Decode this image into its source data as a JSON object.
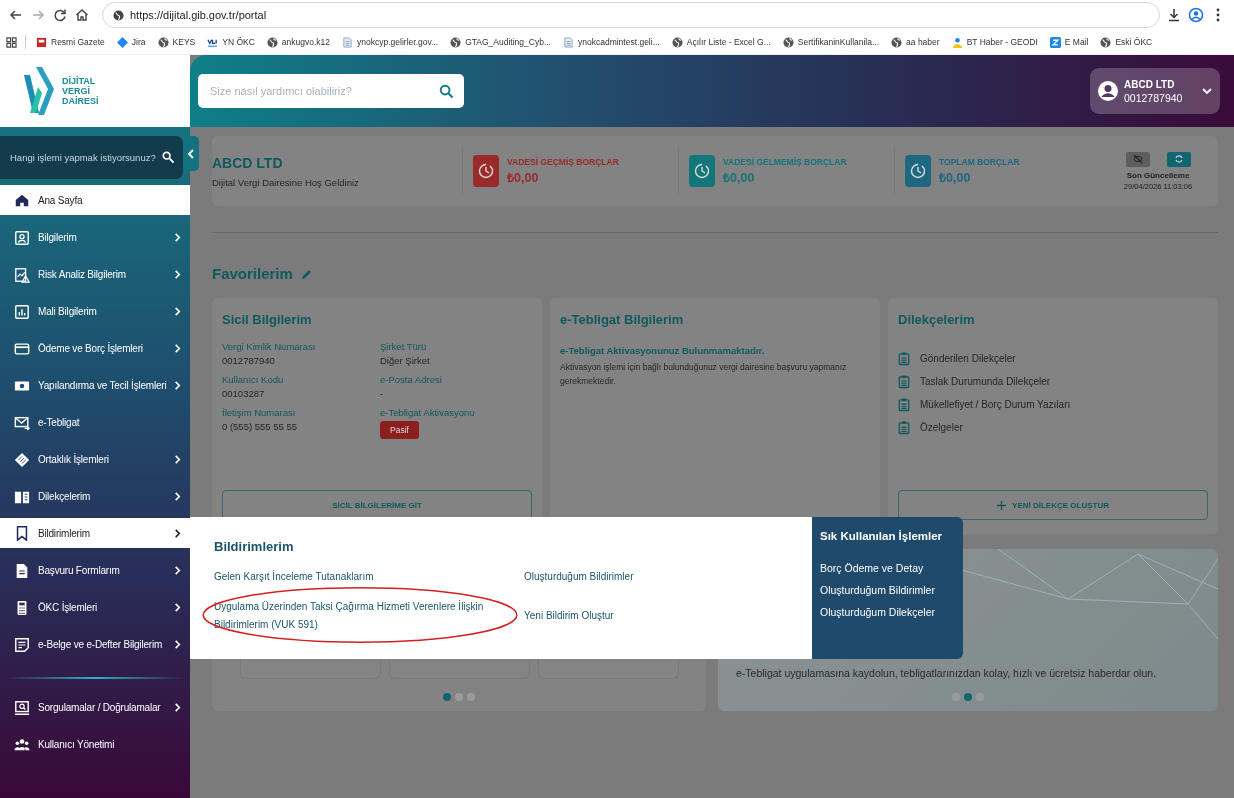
{
  "browser": {
    "url": "https://dijital.gib.gov.tr/portal",
    "bookmarks": [
      {
        "label": "Resmi Gazete",
        "kind": "page"
      },
      {
        "label": "Jira",
        "kind": "diamond"
      },
      {
        "label": "KEYS",
        "kind": "globe"
      },
      {
        "label": "YN ÖKC",
        "kind": "logo"
      },
      {
        "label": "ankugvo.k12",
        "kind": "globe"
      },
      {
        "label": "ynokcyp.gelirler.gov...",
        "kind": "doc"
      },
      {
        "label": "GTAG_Auditing_Cyb...",
        "kind": "globe"
      },
      {
        "label": "ynokcadmintest.geli...",
        "kind": "doc"
      },
      {
        "label": "Açılır Liste - Excel G...",
        "kind": "globe"
      },
      {
        "label": "SertifikaninKullanila...",
        "kind": "globe"
      },
      {
        "label": "aa haber",
        "kind": "globe"
      },
      {
        "label": "BT Haber - GEODI",
        "kind": "person"
      },
      {
        "label": "E Mail",
        "kind": "mail"
      },
      {
        "label": "Eski ÖKC",
        "kind": "globe"
      }
    ]
  },
  "header": {
    "logo_lines": [
      "DİJİTAL",
      "VERGİ",
      "DAİRESİ"
    ],
    "search_placeholder": "Size nasıl yardımcı olabiliriz?",
    "user": {
      "name": "ABCD LTD",
      "number": "0012787940"
    }
  },
  "sidebar": {
    "search_placeholder": "Hangi işlemi yapmak istiyorsunuz?",
    "sections": [
      {
        "items": [
          {
            "label": "Ana Sayfa",
            "has_submenu": false,
            "selected": true
          },
          {
            "label": "Bilgilerim",
            "has_submenu": true,
            "selected": false
          },
          {
            "label": "Risk Analiz Bilgilerim",
            "has_submenu": true,
            "selected": false
          },
          {
            "label": "Mali Bilgilerim",
            "has_submenu": true,
            "selected": false
          },
          {
            "label": "Ödeme ve Borç İşlemleri",
            "has_submenu": true,
            "selected": false
          },
          {
            "label": "Yapılandırma ve Tecil İşlemleri",
            "has_submenu": true,
            "selected": false
          },
          {
            "label": "e-Tebligat",
            "has_submenu": false,
            "selected": false
          },
          {
            "label": "Ortaklık İşlemleri",
            "has_submenu": true,
            "selected": false
          },
          {
            "label": "Dilekçelerim",
            "has_submenu": true,
            "selected": false
          },
          {
            "label": "Bildirimlerim",
            "has_submenu": true,
            "selected": true
          },
          {
            "label": "Başvuru Formlarım",
            "has_submenu": true,
            "selected": false
          },
          {
            "label": "ÖKC İşlemleri",
            "has_submenu": true,
            "selected": false
          },
          {
            "label": "e-Belge ve e-Defter Bilgilerim",
            "has_submenu": true,
            "selected": false
          }
        ]
      },
      {
        "items": [
          {
            "label": "Sorgulamalar / Doğrulamalar",
            "has_submenu": true,
            "selected": false
          },
          {
            "label": "Kullanıcı Yönetimi",
            "has_submenu": false,
            "selected": false
          }
        ]
      }
    ]
  },
  "summary": {
    "company": "ABCD LTD",
    "welcome": "Dijital Vergi Dairesine Hoş Geldiniz",
    "stats": [
      {
        "label": "VADESİ GEÇMİŞ BORÇLAR",
        "amount": "₺0,00",
        "color": "#9b2a2a"
      },
      {
        "label": "VADESİ GELMEMİŞ BORÇLAR",
        "amount": "₺0,00",
        "color": "#13767a"
      },
      {
        "label": "TOPLAM BORÇLAR",
        "amount": "₺0,00",
        "color": "#1d6780"
      }
    ],
    "last_update": {
      "label": "Son Güncelleme",
      "time": "29/04/2026 11:03:06"
    }
  },
  "favorites": {
    "title": "Favorilerim",
    "registry": {
      "title": "Sicil Bilgilerim",
      "fields": [
        {
          "label": "Vergi Kimlik Numarası",
          "value": "0012787940",
          "kind": "text"
        },
        {
          "label": "Şirket Türü",
          "value": "Diğer Şirket",
          "kind": "text"
        },
        {
          "label": "Kullanıcı Kodu",
          "value": "00103287",
          "kind": "text"
        },
        {
          "label": "e-Posta Adresi",
          "value": "-",
          "kind": "text"
        },
        {
          "label": "İletişim Numarası",
          "value": "0 (555) 555 55 55",
          "kind": "text"
        },
        {
          "label": "e-Tebligat Aktivasyonu",
          "value": "Pasif",
          "kind": "badge"
        }
      ],
      "button": "SİCİL BİLGİLERİME GİT"
    },
    "notification": {
      "title": "e-Tebligat Bilgilerim",
      "headline": "e-Tebligat Aktivasyonunuz Bulunmamaktadır.",
      "text": "Aktivasyon işlemi için bağlı bulunduğunuz vergi dairesine başvuru yapmanız gerekmektedir."
    },
    "petitions": {
      "title": "Dilekçelerim",
      "items": [
        "Gönderilen Dilekçeler",
        "Taslak Durumunda Dilekçeler",
        "Mükellefiyet / Borç Durum Yazıları",
        "Özelgeler"
      ],
      "button": "YENİ DİLEKÇE OLUŞTUR"
    }
  },
  "services": {
    "dots": [
      {
        "selected": true
      },
      {
        "selected": false
      },
      {
        "selected": false
      }
    ]
  },
  "banner": {
    "text": "e-Tebligat uygulamasına kaydolun, tebligatlarınızdan kolay, hızlı ve ücretsiz haberdar olun.",
    "dots": [
      {
        "selected": false
      },
      {
        "selected": true
      },
      {
        "selected": false
      }
    ]
  },
  "menu": {
    "title": "Bildirimlerim",
    "links": [
      {
        "label": "Gelen Karşıt İnceleme Tutanaklarım",
        "highlighted": false
      },
      {
        "label": "Oluşturduğum Bildirimler",
        "highlighted": false
      },
      {
        "label": "Uygulama Üzerinden Taksi Çağırma Hizmeti Verenlere İlişkin Bildirimlerim (VUK 591)",
        "highlighted": true
      },
      {
        "label": "Yeni Bildirim Oluştur",
        "highlighted": false
      }
    ],
    "quick": {
      "title": "Sık Kullanılan İşlemler",
      "links": [
        "Borç Ödeme ve Detay",
        "Oluşturduğum Bildirimler",
        "Oluşturduğum Dilekçeler"
      ]
    }
  }
}
